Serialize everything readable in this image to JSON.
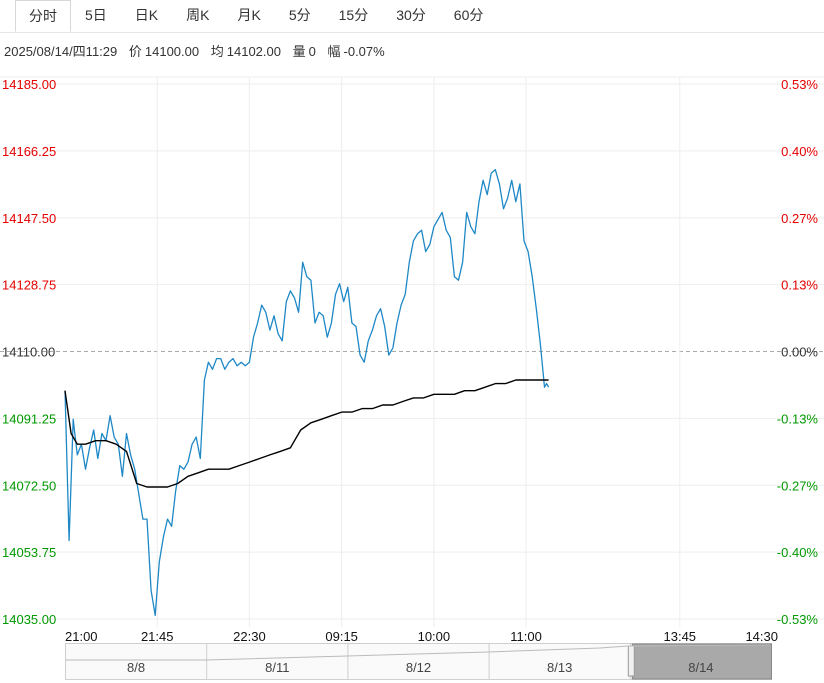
{
  "tabs": [
    {
      "label": "分时",
      "active": true
    },
    {
      "label": "5日",
      "active": false
    },
    {
      "label": "日K",
      "active": false
    },
    {
      "label": "周K",
      "active": false
    },
    {
      "label": "月K",
      "active": false
    },
    {
      "label": "5分",
      "active": false
    },
    {
      "label": "15分",
      "active": false
    },
    {
      "label": "30分",
      "active": false
    },
    {
      "label": "60分",
      "active": false
    }
  ],
  "info": {
    "datetime": "2025/08/14/四11:29",
    "price_label": "价",
    "price": "14100.00",
    "avg_label": "均",
    "avg": "14102.00",
    "vol_label": "量",
    "vol": "0",
    "chg_label": "幅",
    "chg": "-0.07%"
  },
  "colors": {
    "up": "#e60000",
    "down": "#009900",
    "neutral": "#333333",
    "price_line": "#1e88c7",
    "avg_line": "#000000",
    "grid": "#eeeeee"
  },
  "chart_data": {
    "type": "line",
    "prev_close": 14110.0,
    "ylim": [
      14035.0,
      14185.0
    ],
    "y_ticks": [
      "14185.00",
      "14166.25",
      "14147.50",
      "14128.75",
      "14110.00",
      "14091.25",
      "14072.50",
      "14053.75",
      "14035.00"
    ],
    "pct_ticks": [
      "0.53%",
      "0.40%",
      "0.27%",
      "0.13%",
      "0.00%",
      "-0.13%",
      "-0.27%",
      "-0.40%",
      "-0.53%"
    ],
    "x_ticks": [
      "21:00",
      "21:45",
      "22:30",
      "09:15",
      "10:00",
      "11:00",
      "13:45",
      "14:30"
    ],
    "x_range": [
      0,
      345
    ],
    "x_tick_positions": [
      0,
      45,
      90,
      135,
      180,
      225,
      300,
      345
    ],
    "series": [
      {
        "key": "price",
        "x": [
          0,
          2,
          4,
          6,
          8,
          10,
          12,
          14,
          16,
          18,
          20,
          22,
          24,
          26,
          28,
          30,
          32,
          34,
          36,
          38,
          40,
          42,
          44,
          46,
          48,
          50,
          52,
          54,
          56,
          58,
          60,
          62,
          64,
          66,
          68,
          70,
          72,
          74,
          76,
          78,
          80,
          82,
          84,
          86,
          88,
          90,
          92,
          94,
          96,
          98,
          100,
          102,
          104,
          106,
          108,
          110,
          112,
          114,
          116,
          118,
          120,
          122,
          124,
          126,
          128,
          130,
          132,
          134,
          136,
          138,
          140,
          142,
          144,
          146,
          148,
          150,
          152,
          154,
          156,
          158,
          160,
          162,
          164,
          166,
          168,
          170,
          172,
          174,
          176,
          178,
          180,
          182,
          184,
          186,
          188,
          190,
          192,
          194,
          196,
          198,
          200,
          202,
          204,
          206,
          208,
          210,
          212,
          214,
          216,
          218,
          220,
          222,
          224,
          226,
          228,
          230,
          232,
          234,
          235,
          236
        ],
        "y": [
          14099,
          14057,
          14091,
          14081,
          14084,
          14077,
          14083,
          14088,
          14080,
          14087,
          14085,
          14092,
          14086,
          14084,
          14075,
          14087,
          14081,
          14077,
          14070,
          14063,
          14063,
          14043,
          14036,
          14051,
          14058,
          14063,
          14061,
          14071,
          14078,
          14077,
          14079,
          14084,
          14086,
          14080,
          14102,
          14107,
          14105,
          14108,
          14108,
          14105,
          14107,
          14108,
          14106,
          14107,
          14106,
          14107,
          14114,
          14118,
          14123,
          14121,
          14116,
          14120,
          14115,
          14113,
          14124,
          14127,
          14125,
          14121,
          14135,
          14131,
          14130,
          14118,
          14121,
          14120,
          14114,
          14118,
          14126,
          14129,
          14124,
          14128,
          14118,
          14117,
          14109,
          14107,
          14113,
          14116,
          14120,
          14122,
          14117,
          14109,
          14111,
          14118,
          14123,
          14126,
          14135,
          14141,
          14143,
          14144,
          14138,
          14140,
          14145,
          14147,
          14149,
          14144,
          14142,
          14131,
          14130,
          14135,
          14149,
          14145,
          14143,
          14152,
          14158,
          14154,
          14160,
          14161,
          14157,
          14150,
          14153,
          14158,
          14152,
          14157,
          14141,
          14138,
          14131,
          14122,
          14112,
          14100,
          14101,
          14100
        ]
      },
      {
        "key": "avg",
        "x": [
          0,
          3,
          6,
          10,
          15,
          20,
          25,
          30,
          35,
          40,
          45,
          50,
          55,
          60,
          65,
          70,
          75,
          80,
          85,
          90,
          95,
          100,
          105,
          110,
          115,
          120,
          125,
          130,
          135,
          140,
          145,
          150,
          155,
          160,
          165,
          170,
          175,
          180,
          185,
          190,
          195,
          200,
          205,
          210,
          215,
          220,
          225,
          230,
          236
        ],
        "y": [
          14099,
          14087,
          14084,
          14084,
          14085,
          14085,
          14084,
          14082,
          14073,
          14072,
          14072,
          14072,
          14073,
          14075,
          14076,
          14077,
          14077,
          14077,
          14078,
          14079,
          14080,
          14081,
          14082,
          14083,
          14088,
          14090,
          14091,
          14092,
          14093,
          14093,
          14094,
          14094,
          14095,
          14095,
          14096,
          14097,
          14097,
          14098,
          14098,
          14098,
          14099,
          14099,
          14100,
          14101,
          14101,
          14102,
          14102,
          14102,
          14102
        ]
      }
    ],
    "navigator": {
      "days": [
        "8/8",
        "8/11",
        "8/12",
        "8/13",
        "8/14"
      ]
    }
  }
}
